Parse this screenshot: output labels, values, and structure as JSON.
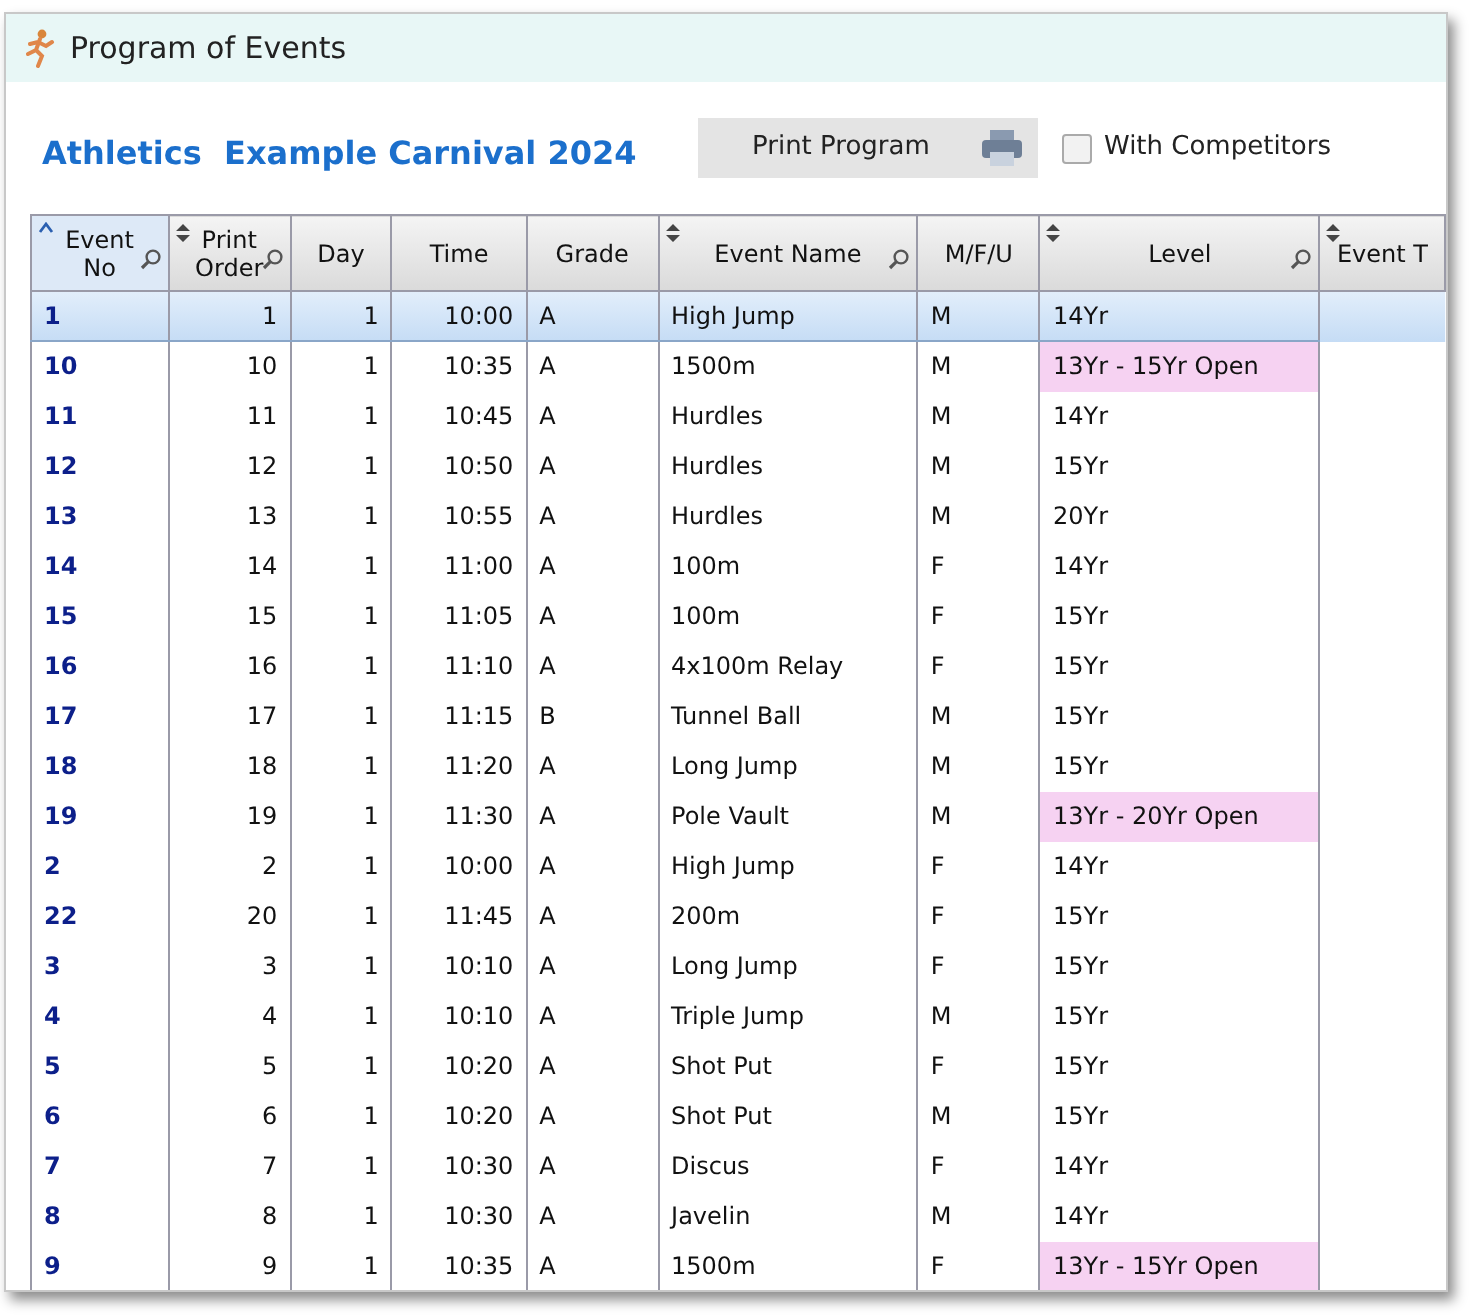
{
  "window": {
    "title": "Program of Events"
  },
  "heading": "Athletics  Example Carnival 2024",
  "print_button": {
    "label": "Print Program"
  },
  "with_competitors": {
    "label": "With Competitors",
    "checked": false
  },
  "table": {
    "columns": [
      {
        "label": "Event No",
        "sortable": true,
        "sorted": true,
        "filter": true
      },
      {
        "label": "Print Order",
        "sortable": true,
        "sorted": false,
        "filter": true
      },
      {
        "label": "Day",
        "sortable": false,
        "sorted": false,
        "filter": false
      },
      {
        "label": "Time",
        "sortable": false,
        "sorted": false,
        "filter": false
      },
      {
        "label": "Grade",
        "sortable": false,
        "sorted": false,
        "filter": false
      },
      {
        "label": "Event Name",
        "sortable": true,
        "sorted": false,
        "filter": true
      },
      {
        "label": "M/F/U",
        "sortable": false,
        "sorted": false,
        "filter": false
      },
      {
        "label": "Level",
        "sortable": true,
        "sorted": false,
        "filter": true
      },
      {
        "label": "Event T",
        "sortable": true,
        "sorted": false,
        "filter": false
      }
    ],
    "rows": [
      {
        "selected": true,
        "event_no": "1",
        "print_order": "1",
        "day": "1",
        "time": "10:00",
        "grade": "A",
        "event_name": "High Jump",
        "mfu": "M",
        "level": "14Yr",
        "open": false
      },
      {
        "selected": false,
        "event_no": "10",
        "print_order": "10",
        "day": "1",
        "time": "10:35",
        "grade": "A",
        "event_name": "1500m",
        "mfu": "M",
        "level": "13Yr - 15Yr Open",
        "open": true
      },
      {
        "selected": false,
        "event_no": "11",
        "print_order": "11",
        "day": "1",
        "time": "10:45",
        "grade": "A",
        "event_name": "Hurdles",
        "mfu": "M",
        "level": "14Yr",
        "open": false
      },
      {
        "selected": false,
        "event_no": "12",
        "print_order": "12",
        "day": "1",
        "time": "10:50",
        "grade": "A",
        "event_name": "Hurdles",
        "mfu": "M",
        "level": "15Yr",
        "open": false
      },
      {
        "selected": false,
        "event_no": "13",
        "print_order": "13",
        "day": "1",
        "time": "10:55",
        "grade": "A",
        "event_name": "Hurdles",
        "mfu": "M",
        "level": "20Yr",
        "open": false
      },
      {
        "selected": false,
        "event_no": "14",
        "print_order": "14",
        "day": "1",
        "time": "11:00",
        "grade": "A",
        "event_name": "100m",
        "mfu": "F",
        "level": "14Yr",
        "open": false
      },
      {
        "selected": false,
        "event_no": "15",
        "print_order": "15",
        "day": "1",
        "time": "11:05",
        "grade": "A",
        "event_name": "100m",
        "mfu": "F",
        "level": "15Yr",
        "open": false
      },
      {
        "selected": false,
        "event_no": "16",
        "print_order": "16",
        "day": "1",
        "time": "11:10",
        "grade": "A",
        "event_name": "4x100m Relay",
        "mfu": "F",
        "level": "15Yr",
        "open": false
      },
      {
        "selected": false,
        "event_no": "17",
        "print_order": "17",
        "day": "1",
        "time": "11:15",
        "grade": "B",
        "event_name": "Tunnel Ball",
        "mfu": "M",
        "level": "15Yr",
        "open": false
      },
      {
        "selected": false,
        "event_no": "18",
        "print_order": "18",
        "day": "1",
        "time": "11:20",
        "grade": "A",
        "event_name": "Long Jump",
        "mfu": "M",
        "level": "15Yr",
        "open": false
      },
      {
        "selected": false,
        "event_no": "19",
        "print_order": "19",
        "day": "1",
        "time": "11:30",
        "grade": "A",
        "event_name": "Pole Vault",
        "mfu": "M",
        "level": "13Yr - 20Yr Open",
        "open": true
      },
      {
        "selected": false,
        "event_no": "2",
        "print_order": "2",
        "day": "1",
        "time": "10:00",
        "grade": "A",
        "event_name": "High Jump",
        "mfu": "F",
        "level": "14Yr",
        "open": false
      },
      {
        "selected": false,
        "event_no": "22",
        "print_order": "20",
        "day": "1",
        "time": "11:45",
        "grade": "A",
        "event_name": "200m",
        "mfu": "F",
        "level": "15Yr",
        "open": false
      },
      {
        "selected": false,
        "event_no": "3",
        "print_order": "3",
        "day": "1",
        "time": "10:10",
        "grade": "A",
        "event_name": "Long Jump",
        "mfu": "F",
        "level": "15Yr",
        "open": false
      },
      {
        "selected": false,
        "event_no": "4",
        "print_order": "4",
        "day": "1",
        "time": "10:10",
        "grade": "A",
        "event_name": "Triple Jump",
        "mfu": "M",
        "level": "15Yr",
        "open": false
      },
      {
        "selected": false,
        "event_no": "5",
        "print_order": "5",
        "day": "1",
        "time": "10:20",
        "grade": "A",
        "event_name": "Shot Put",
        "mfu": "F",
        "level": "15Yr",
        "open": false
      },
      {
        "selected": false,
        "event_no": "6",
        "print_order": "6",
        "day": "1",
        "time": "10:20",
        "grade": "A",
        "event_name": "Shot Put",
        "mfu": "M",
        "level": "15Yr",
        "open": false
      },
      {
        "selected": false,
        "event_no": "7",
        "print_order": "7",
        "day": "1",
        "time": "10:30",
        "grade": "A",
        "event_name": "Discus",
        "mfu": "F",
        "level": "14Yr",
        "open": false
      },
      {
        "selected": false,
        "event_no": "8",
        "print_order": "8",
        "day": "1",
        "time": "10:30",
        "grade": "A",
        "event_name": "Javelin",
        "mfu": "M",
        "level": "14Yr",
        "open": false
      },
      {
        "selected": false,
        "event_no": "9",
        "print_order": "9",
        "day": "1",
        "time": "10:35",
        "grade": "A",
        "event_name": "1500m",
        "mfu": "F",
        "level": "13Yr - 15Yr Open",
        "open": true
      }
    ]
  }
}
